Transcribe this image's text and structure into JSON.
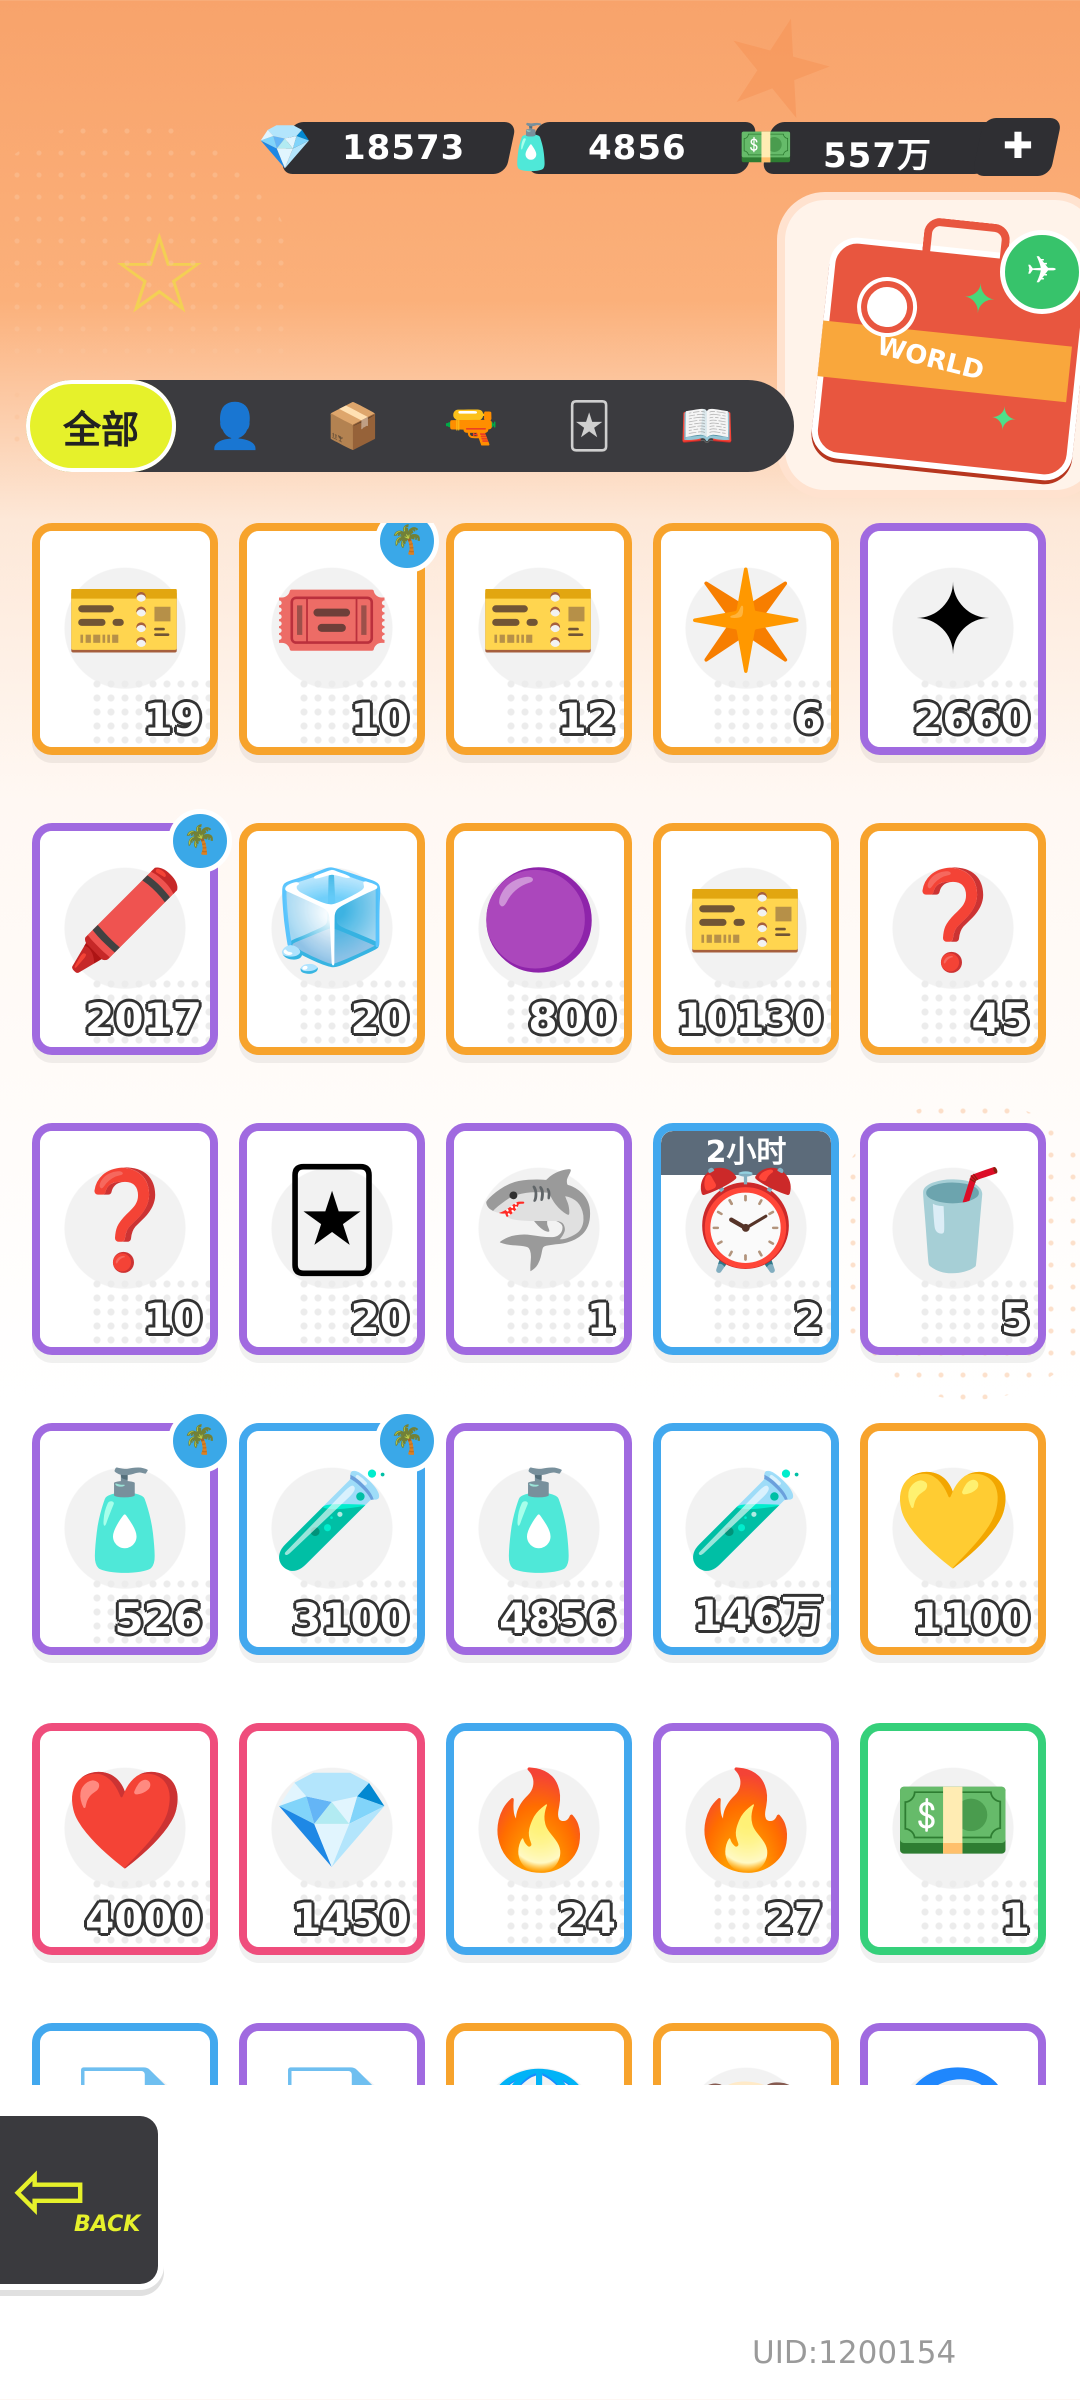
{
  "currency": [
    {
      "icon": "diamond-icon",
      "glyph": "💎",
      "value": "18573"
    },
    {
      "icon": "spray-can-icon",
      "glyph": "🧴",
      "value": "4856"
    },
    {
      "icon": "cash-icon",
      "glyph": "💵",
      "value": "557万"
    }
  ],
  "add_icon_glyph": "✚",
  "suitcase": {
    "label": "WORLD"
  },
  "tabs": [
    {
      "label": "全部",
      "icon": ""
    },
    {
      "label": "",
      "icon": "👤"
    },
    {
      "label": "",
      "icon": "📦"
    },
    {
      "label": "",
      "icon": "🔫"
    },
    {
      "label": "",
      "icon": "🃏"
    },
    {
      "label": "",
      "icon": "📖"
    }
  ],
  "items": [
    {
      "color": "orange",
      "glyph": "🎫",
      "count": "19"
    },
    {
      "color": "orange",
      "glyph": "🎟️",
      "count": "10",
      "badge": true
    },
    {
      "color": "orange",
      "glyph": "🎫",
      "count": "12"
    },
    {
      "color": "orange",
      "glyph": "✴️",
      "count": "6"
    },
    {
      "color": "purple",
      "glyph": "✦",
      "count": "2660"
    },
    {
      "color": "purple",
      "glyph": "🖍️",
      "count": "2017",
      "badge": true
    },
    {
      "color": "orange",
      "glyph": "🧊",
      "count": "20"
    },
    {
      "color": "orange",
      "glyph": "🟣",
      "count": "800"
    },
    {
      "color": "orange",
      "glyph": "🎫",
      "count": "10130"
    },
    {
      "color": "orange",
      "glyph": "❓",
      "count": "45"
    },
    {
      "color": "purple",
      "glyph": "❓",
      "count": "10"
    },
    {
      "color": "purple",
      "glyph": "🃏",
      "count": "20"
    },
    {
      "color": "purple",
      "glyph": "🦈",
      "count": "1"
    },
    {
      "color": "blue",
      "glyph": "⏰",
      "count": "2",
      "timer": "2小时"
    },
    {
      "color": "purple",
      "glyph": "🥤",
      "count": "5"
    },
    {
      "color": "purple",
      "glyph": "🧴",
      "count": "526",
      "badge": true
    },
    {
      "color": "blue",
      "glyph": "🧪",
      "count": "3100",
      "badge": true
    },
    {
      "color": "purple",
      "glyph": "🧴",
      "count": "4856"
    },
    {
      "color": "blue",
      "glyph": "🧪",
      "count": "146万"
    },
    {
      "color": "orange",
      "glyph": "💛",
      "count": "1100"
    },
    {
      "color": "pink",
      "glyph": "❤️",
      "count": "4000"
    },
    {
      "color": "pink",
      "glyph": "💎",
      "count": "1450"
    },
    {
      "color": "blue",
      "glyph": "🔥",
      "count": "24"
    },
    {
      "color": "purple",
      "glyph": "🔥",
      "count": "27"
    },
    {
      "color": "green",
      "glyph": "💵",
      "count": "1"
    },
    {
      "color": "blue",
      "glyph": "📄",
      "count": ""
    },
    {
      "color": "purple",
      "glyph": "📄",
      "count": ""
    },
    {
      "color": "orange",
      "glyph": "🌐",
      "count": ""
    },
    {
      "color": "orange",
      "glyph": "🐶",
      "count": ""
    },
    {
      "color": "purple",
      "glyph": "🌀",
      "count": ""
    }
  ],
  "back_label": "BACK",
  "uid": "UID:1200154"
}
